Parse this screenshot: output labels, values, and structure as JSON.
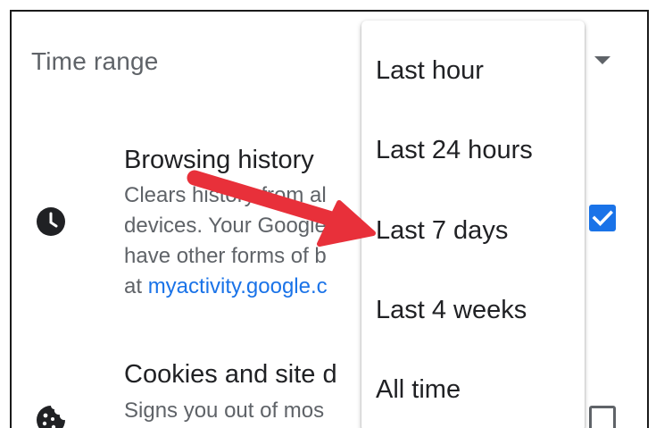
{
  "time_range": {
    "label": "Time range"
  },
  "items": [
    {
      "title": "Browsing history",
      "desc_lines": [
        "Clears history from al",
        "devices. Your Google",
        "have other forms of b"
      ],
      "desc_prefix": "at ",
      "link": "myactivity.google.c",
      "icon": "clock-icon",
      "checked": true
    },
    {
      "title": "Cookies and site d",
      "desc_lines": [
        "Signs you out of mos"
      ],
      "icon": "cookie-icon",
      "checked": false
    }
  ],
  "menu": {
    "options": [
      "Last hour",
      "Last 24 hours",
      "Last 7 days",
      "Last 4 weeks",
      "All time"
    ]
  },
  "colors": {
    "accent": "#1a73e8",
    "annotation_arrow": "#e8303a",
    "text_primary": "#202124",
    "text_secondary": "#5f6368"
  }
}
